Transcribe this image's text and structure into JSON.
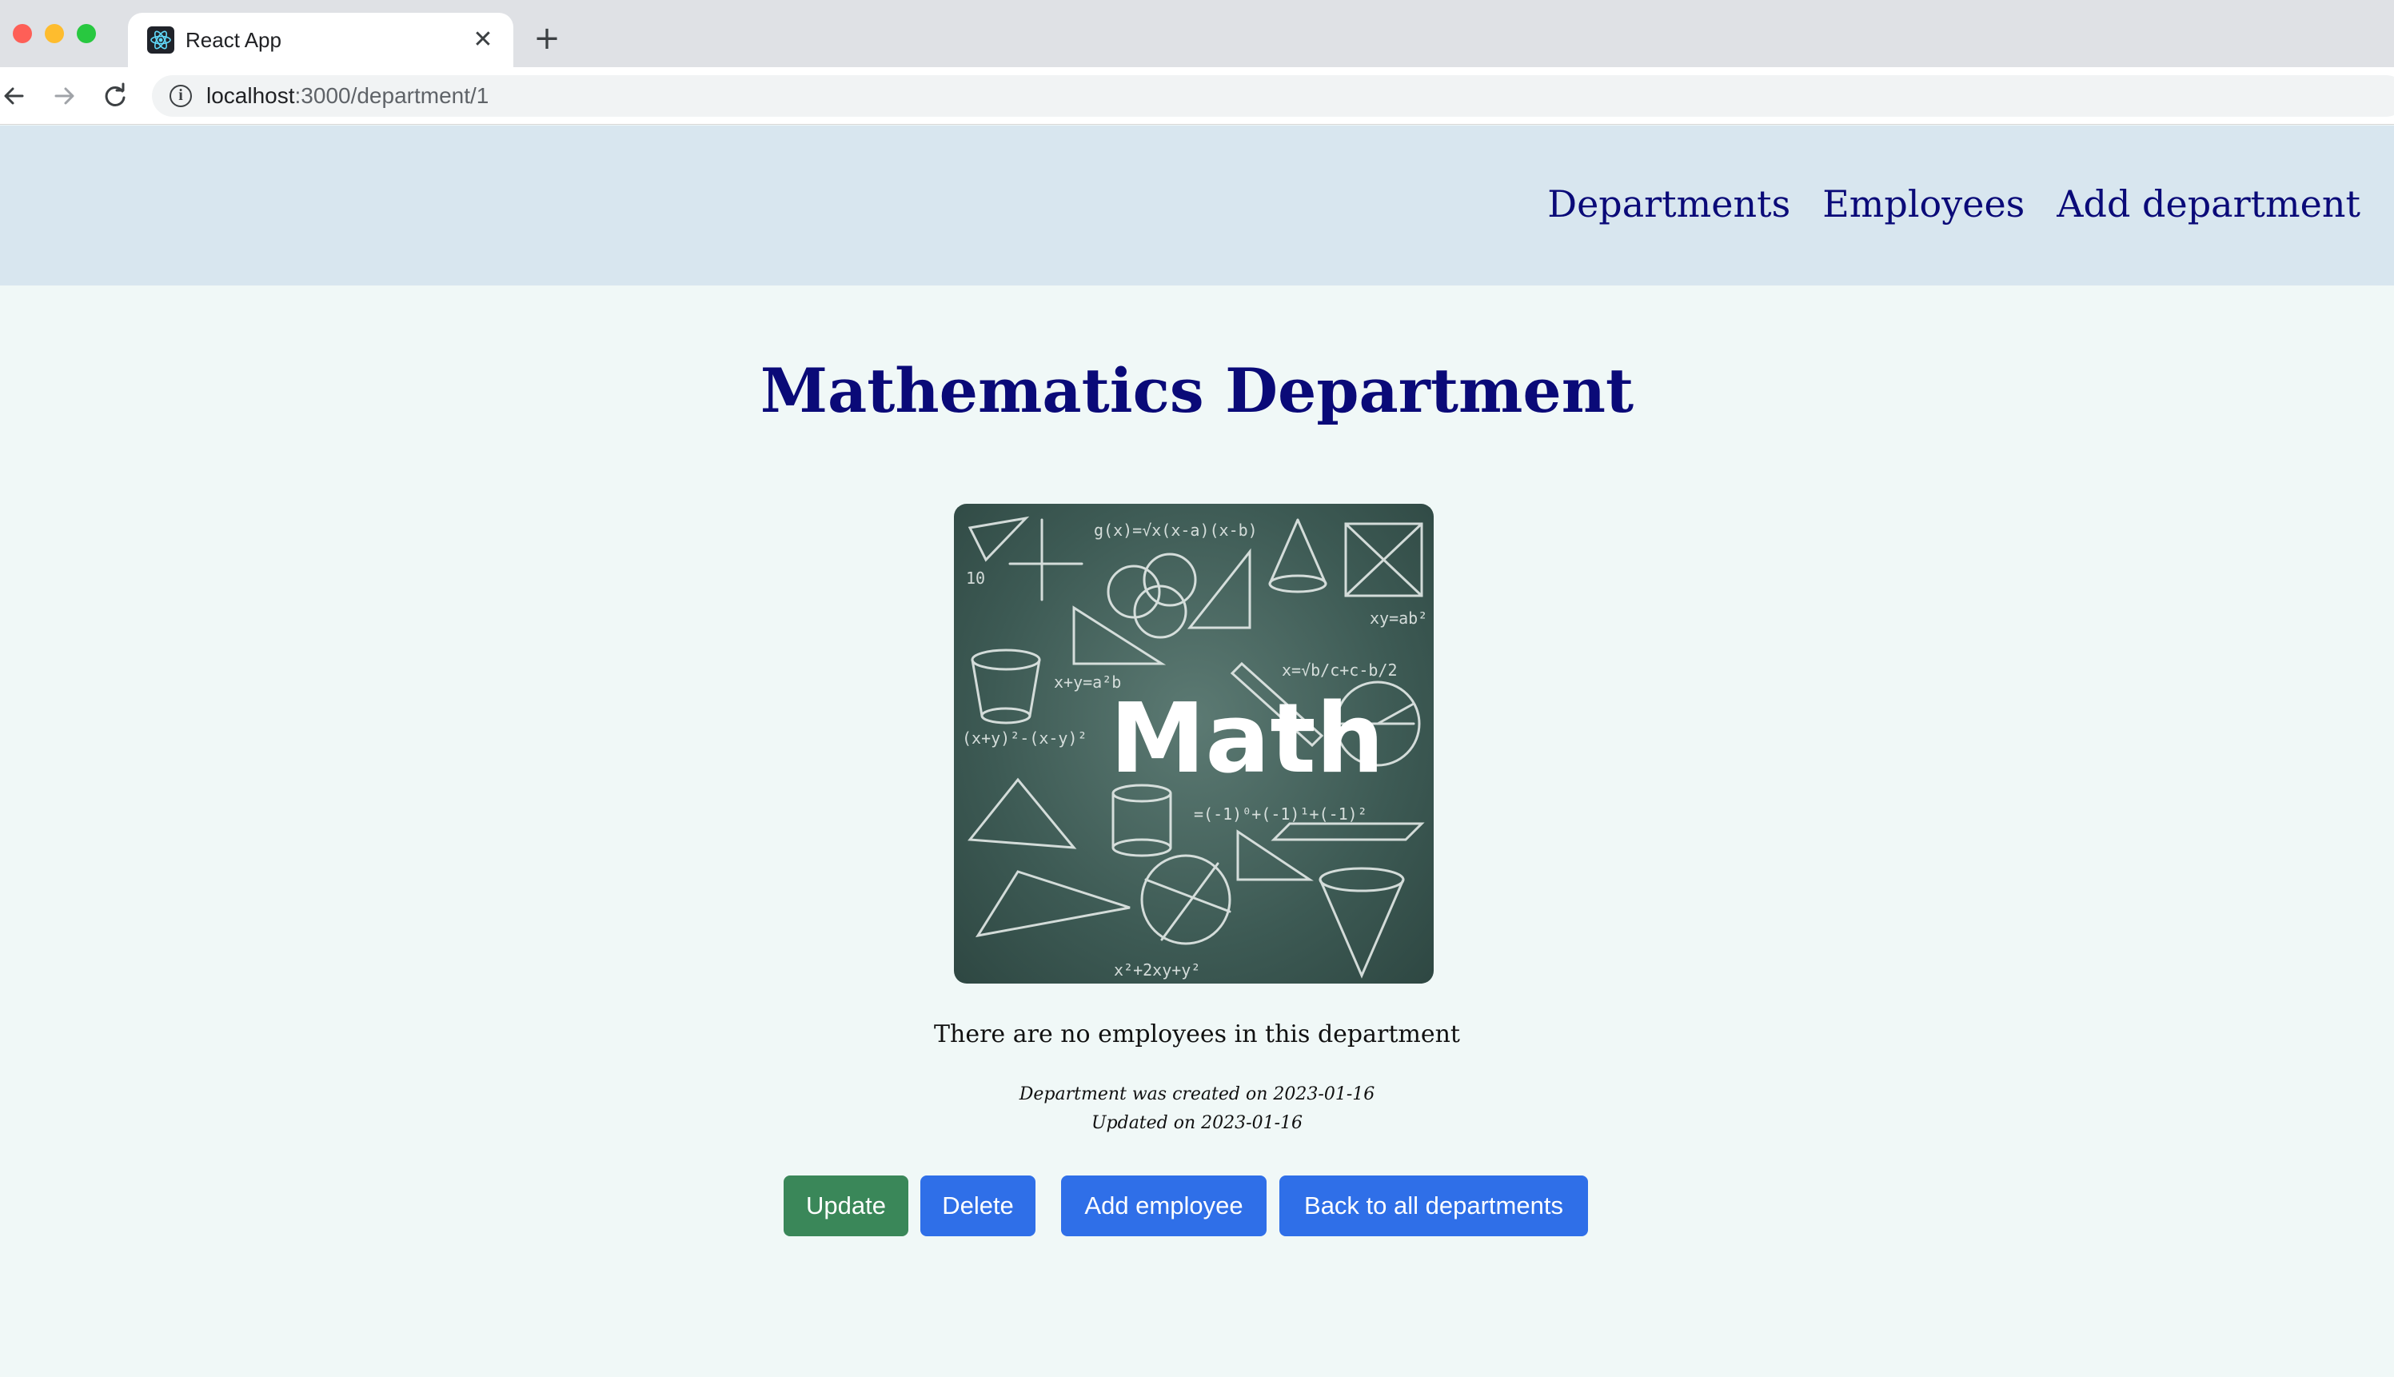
{
  "browser": {
    "tab_title": "React App",
    "tab_close": "✕",
    "new_tab": "+",
    "url_host": "localhost",
    "url_path": ":3000/department/1"
  },
  "nav": {
    "departments": "Departments",
    "employees": "Employees",
    "add_department": "Add department"
  },
  "department": {
    "title": "Mathematics Department",
    "image_text": "Math",
    "employees_message": "There are no employees in this department",
    "created_text": "Department was created on 2023-01-16",
    "updated_text": "Updated on 2023-01-16"
  },
  "buttons": {
    "update": "Update",
    "delete": "Delete",
    "add_employee": "Add employee",
    "back": "Back to all departments"
  },
  "colors": {
    "nav_text": "#0a0a78",
    "header_bg": "#d8e6ef",
    "page_bg": "#f0f8f7",
    "update_button": "#3a8759",
    "primary_button": "#2f6fe8",
    "chalkboard": "#3d5a54"
  },
  "icons": {
    "back": "arrow-left-icon",
    "forward": "arrow-right-icon",
    "reload": "reload-icon",
    "info": "info-icon",
    "favicon": "react-logo-icon"
  }
}
